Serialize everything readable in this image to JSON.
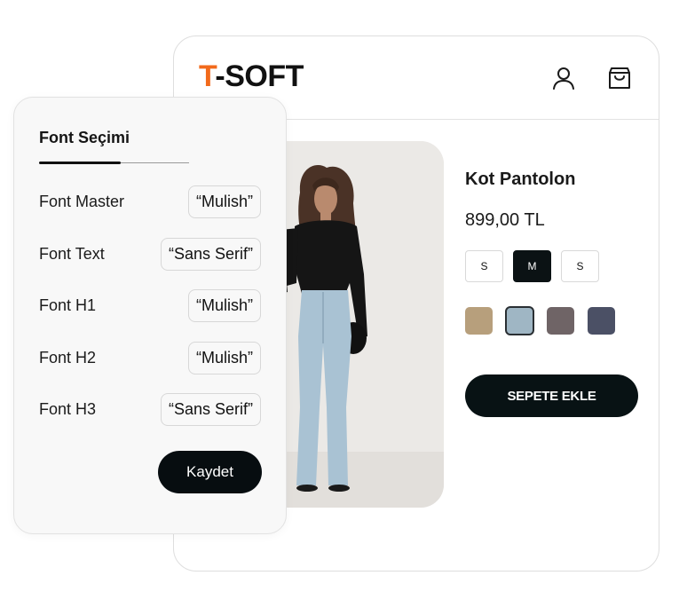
{
  "shop": {
    "logo_accent": "T",
    "logo_rest": "-SOFT",
    "icons": [
      "user-icon",
      "shopping-bag-icon"
    ]
  },
  "product": {
    "title": "Kot Pantolon",
    "price": "899,00 TL",
    "sizes": [
      {
        "label": "S",
        "active": false
      },
      {
        "label": "M",
        "active": true
      },
      {
        "label": "S",
        "active": false
      }
    ],
    "colors": [
      {
        "hex": "#b79f7c",
        "selected": false
      },
      {
        "hex": "#9fb6c4",
        "selected": true
      },
      {
        "hex": "#6f6466",
        "selected": false
      },
      {
        "hex": "#4b5065",
        "selected": false
      }
    ],
    "add_to_cart_label": "SEPETE EKLE"
  },
  "font_panel": {
    "title": "Font Seçimi",
    "rows": [
      {
        "label": "Font Master",
        "value": "“Mulish”"
      },
      {
        "label": "Font Text",
        "value": "“Sans Serif”"
      },
      {
        "label": "Font H1",
        "value": "“Mulish”"
      },
      {
        "label": "Font H2",
        "value": "“Mulish”"
      },
      {
        "label": "Font H3",
        "value": "“Sans Serif”"
      }
    ],
    "save_label": "Kaydet"
  },
  "colors": {
    "accent": "#f26a1b",
    "button_dark": "#081214"
  }
}
